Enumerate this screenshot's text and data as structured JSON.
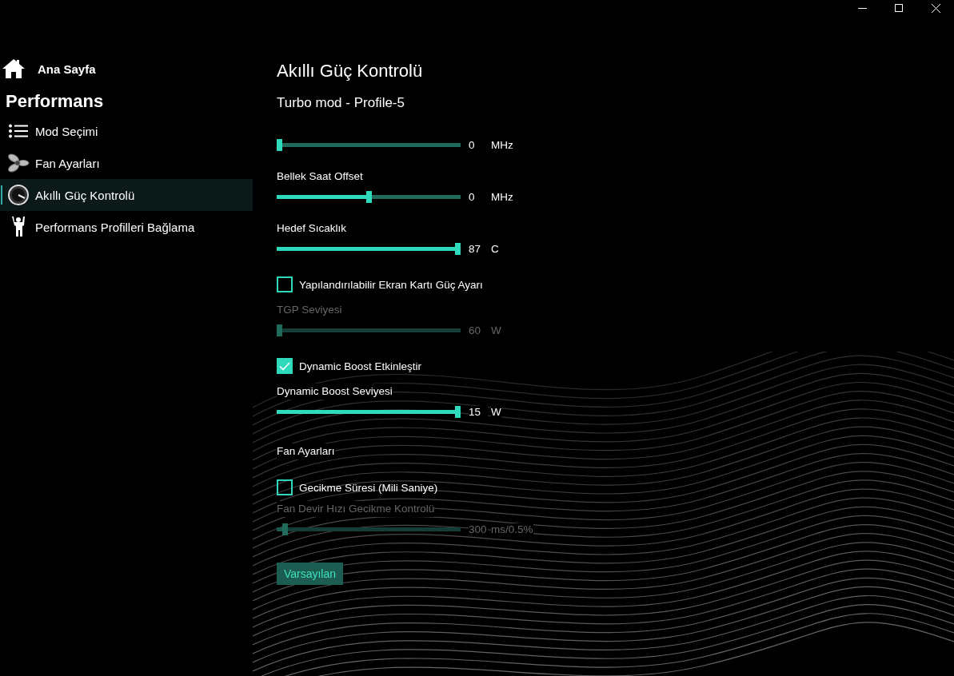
{
  "sidebar": {
    "home": {
      "label": "Ana Sayfa"
    },
    "section": "Performans",
    "items": [
      {
        "label": "Mod Seçimi",
        "selected": false
      },
      {
        "label": "Fan Ayarları",
        "selected": false
      },
      {
        "label": "Akıllı Güç Kontrolü",
        "selected": true
      },
      {
        "label": "Performans Profilleri Bağlama",
        "selected": false
      }
    ]
  },
  "main": {
    "title": "Akıllı Güç Kontrolü",
    "subtitle": "Turbo mod - Profile-5",
    "controls": [
      {
        "kind": "slider",
        "level": 0,
        "value": "0",
        "unit": "MHz",
        "disabled": false
      },
      {
        "kind": "slider",
        "label": "Bellek Saat Offset",
        "level": 0.5,
        "value": "0",
        "unit": "MHz",
        "disabled": false
      },
      {
        "kind": "slider",
        "label": "Hedef Sıcaklık",
        "level": 1,
        "value": "87",
        "unit": "C",
        "disabled": false
      },
      {
        "kind": "checkbox",
        "label": "Yapılandırılabilir Ekran Kartı Güç Ayarı",
        "checked": false
      },
      {
        "kind": "slider",
        "label": "TGP Seviyesi",
        "level": 0,
        "value": "60",
        "unit": "W",
        "disabled": true
      },
      {
        "kind": "checkbox",
        "label": "Dynamic Boost Etkinleştir",
        "checked": true
      },
      {
        "kind": "slider",
        "label": "Dynamic Boost Seviyesi",
        "level": 1,
        "value": "15",
        "unit": "W",
        "disabled": false
      },
      {
        "kind": "heading",
        "label": "Fan Ayarları"
      },
      {
        "kind": "checkbox",
        "label": "Gecikme Süresi (Mili Saniye)",
        "checked": false
      },
      {
        "kind": "slider",
        "label": "Fan Devir Hızı Gecikme Kontrolü",
        "level": 0.03,
        "value": "300",
        "unit": "ms/0.5%",
        "disabled": true
      },
      {
        "kind": "button",
        "label": "Varsayılan"
      }
    ]
  }
}
